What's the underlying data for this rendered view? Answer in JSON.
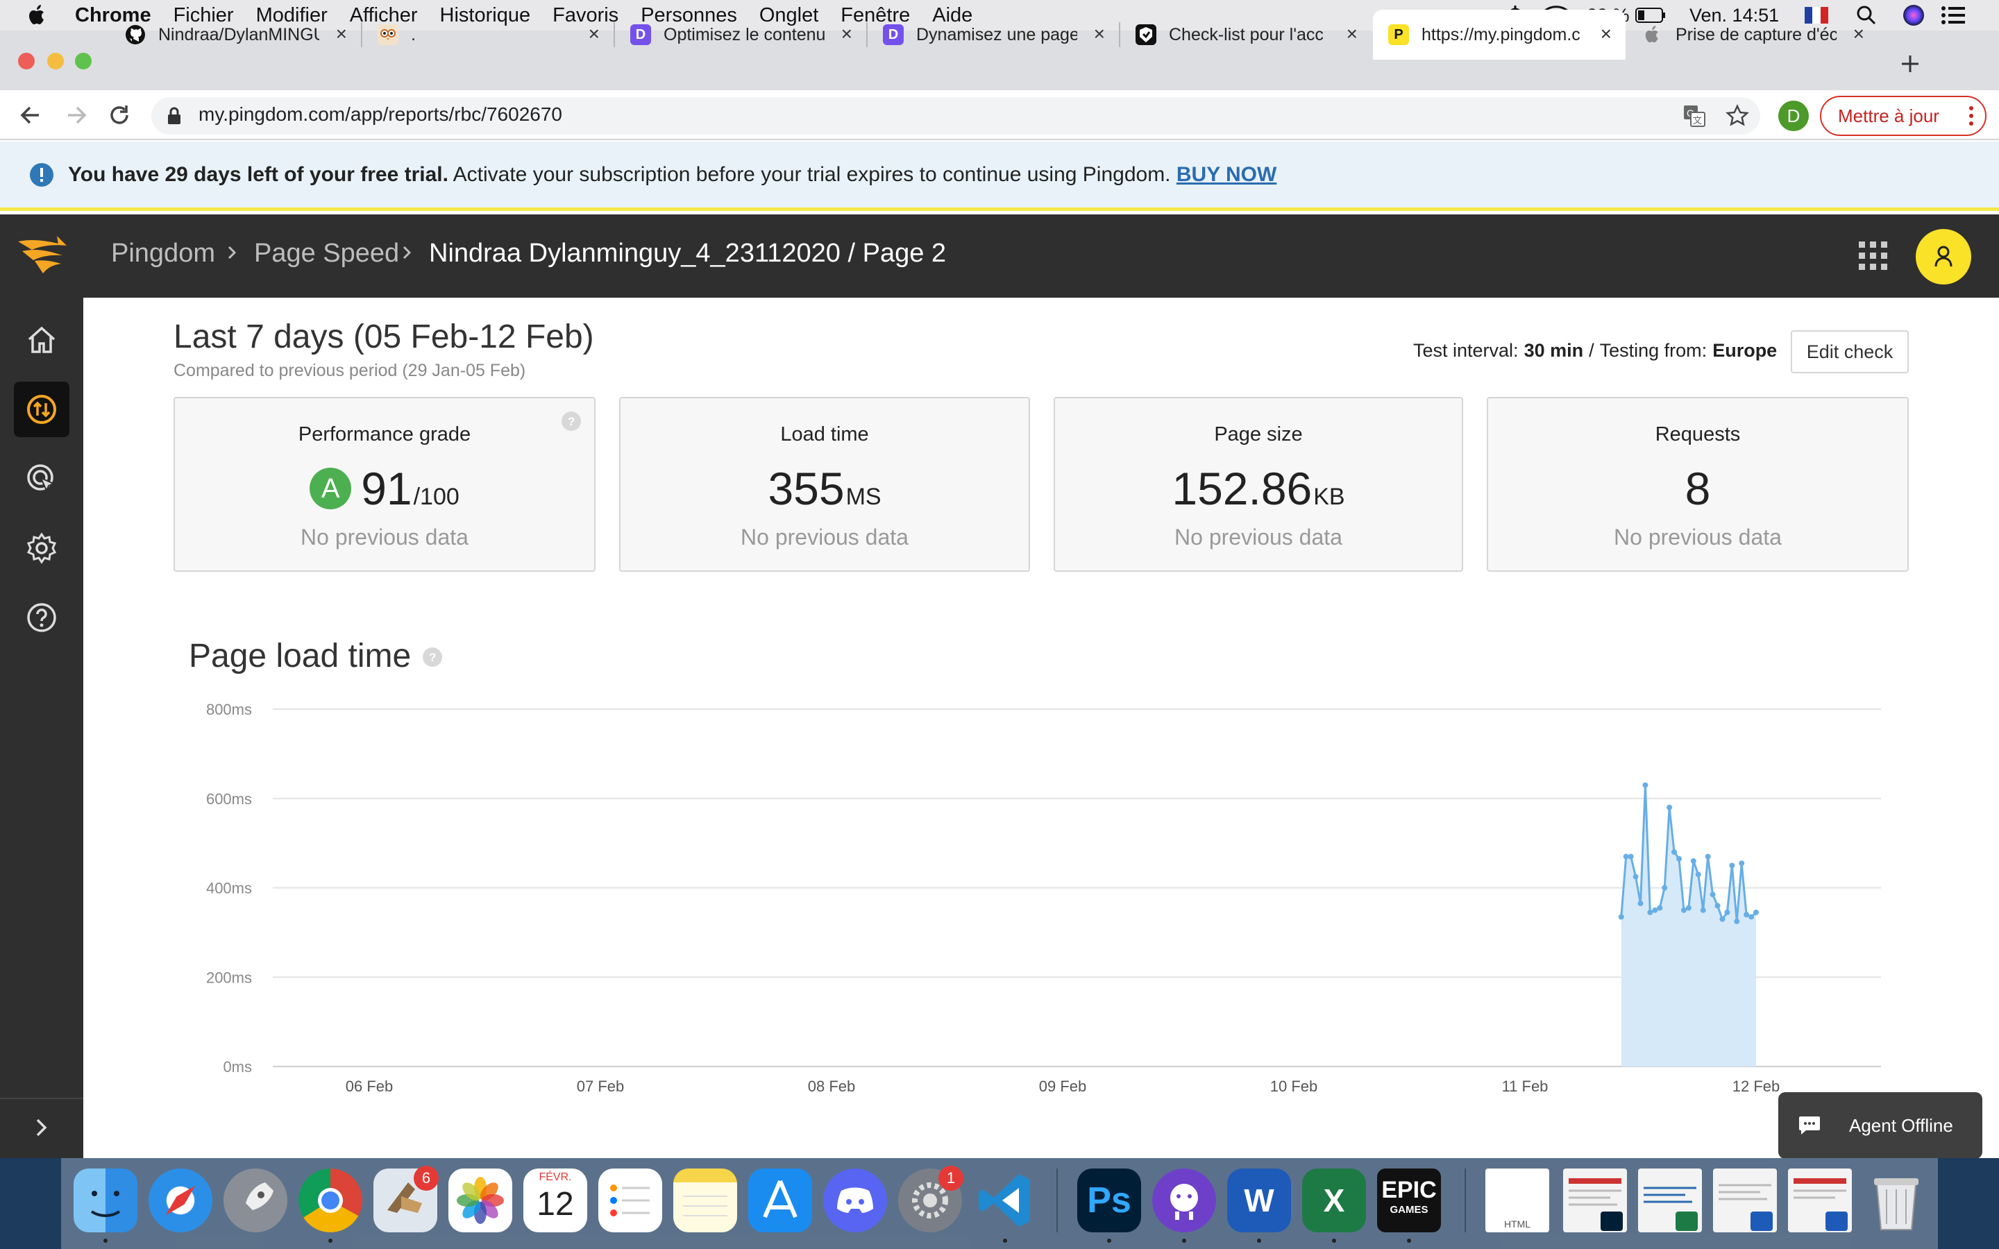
{
  "menubar": {
    "app": "Chrome",
    "items": [
      "Fichier",
      "Modifier",
      "Afficher",
      "Historique",
      "Favoris",
      "Personnes",
      "Onglet",
      "Fenêtre",
      "Aide"
    ],
    "battery": "23 %",
    "clock": "Ven. 14:51"
  },
  "tabs": [
    {
      "title": "Nindraa/DylanMINGU",
      "icon": "github-icon"
    },
    {
      "title": ".",
      "icon": "owl-icon"
    },
    {
      "title": "Optimisez le contenu",
      "icon": "openclassrooms-icon"
    },
    {
      "title": "Dynamisez une page",
      "icon": "openclassrooms-icon"
    },
    {
      "title": "Check-list pour l'acc",
      "icon": "opquast-icon"
    },
    {
      "title": "https://my.pingdom.c",
      "icon": "pingdom-icon"
    },
    {
      "title": "Prise de capture d'éc",
      "icon": "apple-icon"
    }
  ],
  "address": {
    "url": "my.pingdom.com/app/reports/rbc/7602670",
    "profile_letter": "D",
    "update_label": "Mettre à jour"
  },
  "trial": {
    "bold": "You have 29 days left of your free trial.",
    "text": " Activate your subscription before your trial expires to continue using Pingdom. ",
    "link": "BUY NOW"
  },
  "header": {
    "crumbs": [
      "Pingdom",
      "Page Speed",
      "Nindraa Dylanminguy_4_23112020 / Page 2"
    ]
  },
  "report": {
    "period": "Last 7 days (05 Feb-12 Feb)",
    "compare": "Compared to previous period (29 Jan-05 Feb)",
    "interval_label": "Test interval:",
    "interval_value": "30 min",
    "sep": "/",
    "testing_label": "Testing from:",
    "testing_value": "Europe",
    "edit_label": "Edit check"
  },
  "cards": [
    {
      "title": "Performance grade",
      "grade": "A",
      "value": "91",
      "unit": "/100",
      "sub": "No previous data"
    },
    {
      "title": "Load time",
      "value": "355",
      "unit": "MS",
      "sub": "No previous data"
    },
    {
      "title": "Page size",
      "value": "152.86",
      "unit": "KB",
      "sub": "No previous data"
    },
    {
      "title": "Requests",
      "value": "8",
      "unit": "",
      "sub": "No previous data"
    }
  ],
  "chart_section": {
    "title": "Page load time"
  },
  "chart_data": {
    "type": "area",
    "title": "Page load time",
    "xlabel": "",
    "ylabel": "",
    "y_ticks": [
      "0ms",
      "200ms",
      "400ms",
      "600ms",
      "800ms"
    ],
    "x_ticks": [
      "06 Feb",
      "07 Feb",
      "08 Feb",
      "09 Feb",
      "10 Feb",
      "11 Feb",
      "12 Feb"
    ],
    "ylim": [
      0,
      800
    ],
    "grid": true,
    "legend": "none",
    "series": [
      {
        "points": [
          [
            "11 Feb 10:00",
            335
          ],
          [
            "11 Feb 10:30",
            470
          ],
          [
            "11 Feb 11:00",
            470
          ],
          [
            "11 Feb 11:30",
            425
          ],
          [
            "11 Feb 12:00",
            365
          ],
          [
            "11 Feb 12:30",
            630
          ],
          [
            "11 Feb 13:00",
            345
          ],
          [
            "11 Feb 13:30",
            350
          ],
          [
            "11 Feb 14:00",
            355
          ],
          [
            "11 Feb 14:30",
            400
          ],
          [
            "11 Feb 15:00",
            580
          ],
          [
            "11 Feb 15:30",
            480
          ],
          [
            "11 Feb 16:00",
            465
          ],
          [
            "11 Feb 16:30",
            350
          ],
          [
            "11 Feb 17:00",
            355
          ],
          [
            "11 Feb 17:30",
            460
          ],
          [
            "11 Feb 18:00",
            430
          ],
          [
            "11 Feb 18:30",
            350
          ],
          [
            "11 Feb 19:00",
            470
          ],
          [
            "11 Feb 19:30",
            385
          ],
          [
            "11 Feb 20:00",
            360
          ],
          [
            "11 Feb 20:30",
            330
          ],
          [
            "11 Feb 21:00",
            345
          ],
          [
            "11 Feb 21:30",
            450
          ],
          [
            "11 Feb 22:00",
            325
          ],
          [
            "11 Feb 22:30",
            455
          ],
          [
            "11 Feb 23:00",
            340
          ],
          [
            "11 Feb 23:30",
            335
          ],
          [
            "12 Feb 00:00",
            345
          ]
        ]
      }
    ],
    "colors": {
      "line": "#67aee6",
      "fill": "#d6e9f9"
    }
  },
  "agent": {
    "label": "Agent Offline"
  },
  "dock": {
    "icons": [
      "finder-icon",
      "safari-icon",
      "launchpad-icon",
      "chrome-icon",
      "mail-icon",
      "photos-icon",
      "calendar-icon",
      "reminders-icon",
      "notes-icon",
      "appstore-icon",
      "discord-icon",
      "system-preferences-icon",
      "vscode-icon",
      "photoshop-icon",
      "github-desktop-icon",
      "word-icon",
      "excel-icon",
      "epic-games-icon",
      "html-file-icon",
      "document-icon",
      "document-icon",
      "document-icon",
      "document-icon",
      "trash-icon"
    ],
    "mail_badge": "6",
    "prefs_badge": "1",
    "cal_month": "FÉVR.",
    "cal_day": "12",
    "ps_label": "Ps",
    "word_label": "W",
    "excel_label": "X",
    "epic_top": "EPIC",
    "epic_bottom": "GAMES",
    "html_label": "HTML"
  },
  "colors": {
    "accent": "#f5a623",
    "header_bg": "#2f2f2f",
    "link": "#2b6cb0",
    "grade_green": "#4caf50",
    "avatar_yellow": "#f9e227"
  }
}
